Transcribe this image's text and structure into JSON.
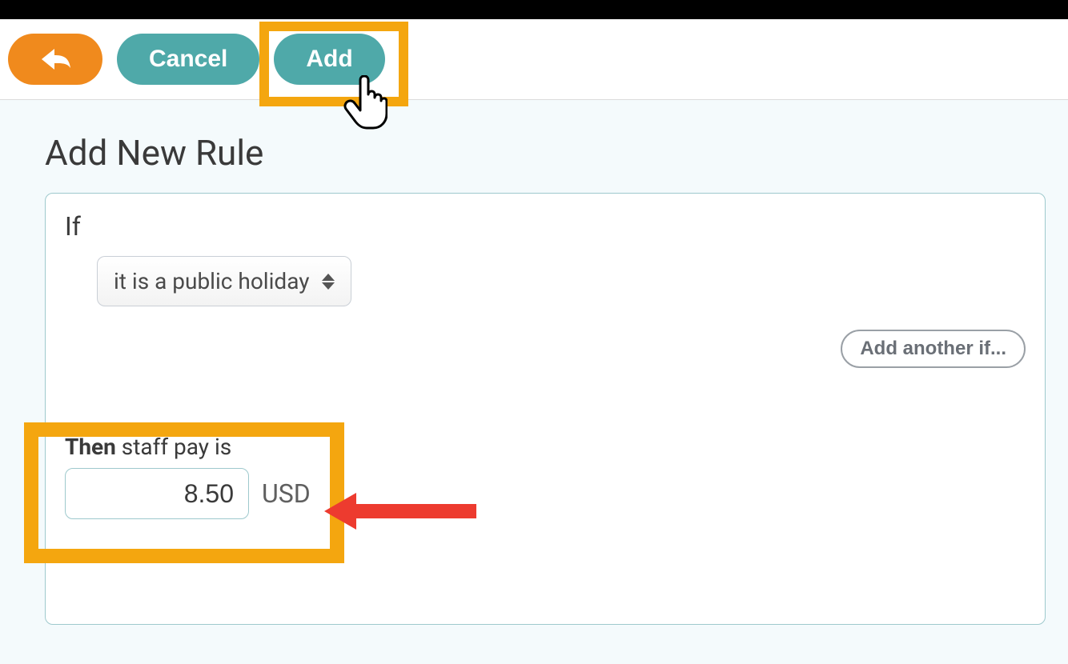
{
  "header": {
    "cancel_label": "Cancel",
    "add_label": "Add"
  },
  "page": {
    "title": "Add New Rule"
  },
  "rule": {
    "if_label": "If",
    "condition_selected": "it is a public holiday",
    "add_another_label": "Add another if...",
    "then_bold": "Then",
    "then_rest": " staff pay is",
    "pay_value": "8.50",
    "currency": "USD"
  }
}
